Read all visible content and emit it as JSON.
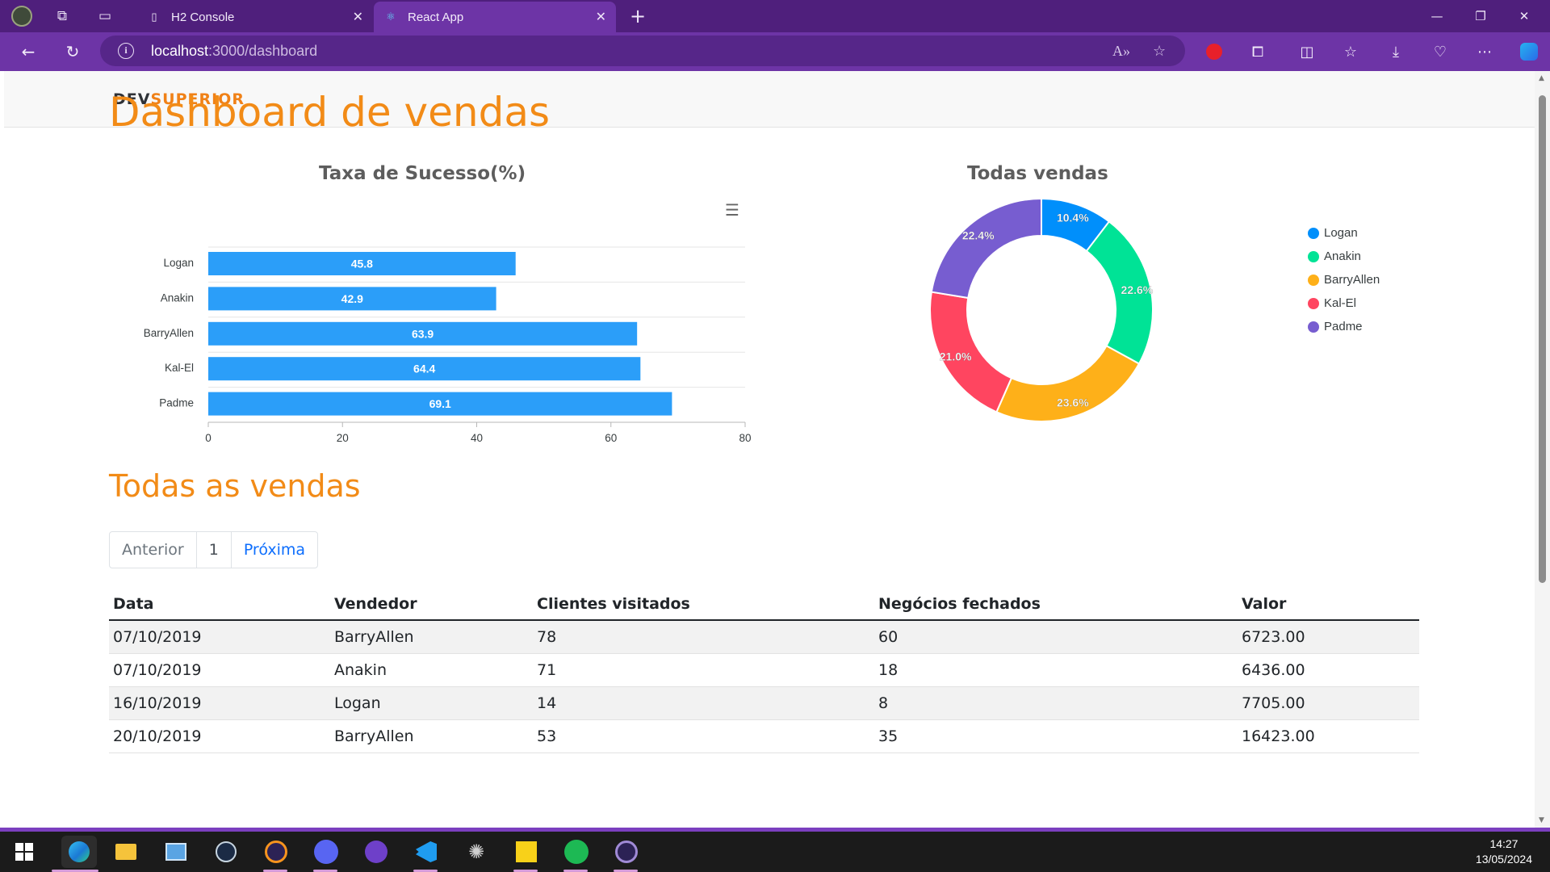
{
  "browser": {
    "tabs": [
      {
        "title": "H2 Console",
        "active": false
      },
      {
        "title": "React App",
        "active": true
      }
    ],
    "url_host": "localhost",
    "url_rest": ":3000/dashboard"
  },
  "site": {
    "logo_dev": "DEV",
    "logo_superior": "SUPERIOR",
    "page_title": "Dashboard de vendas",
    "section_title": "Todas as vendas"
  },
  "bar_chart_title": "Taxa de Sucesso(%)",
  "donut_chart_title": "Todas vendas",
  "colors": {
    "accent": "#f28b17",
    "bar": "#2b9ef9",
    "donut": [
      "#008ffb",
      "#00e396",
      "#feb019",
      "#ff4560",
      "#775dd0"
    ]
  },
  "chart_data": [
    {
      "type": "bar",
      "orientation": "horizontal",
      "title": "Taxa de Sucesso(%)",
      "categories": [
        "Logan",
        "Anakin",
        "BarryAllen",
        "Kal-El",
        "Padme"
      ],
      "values": [
        45.8,
        42.9,
        63.9,
        64.4,
        69.1
      ],
      "xlim": [
        0,
        80
      ],
      "xticks": [
        0,
        20,
        40,
        60,
        80
      ],
      "grid": true
    },
    {
      "type": "pie",
      "donut": true,
      "title": "Todas vendas",
      "labels": [
        "Logan",
        "Anakin",
        "BarryAllen",
        "Kal-El",
        "Padme"
      ],
      "values": [
        10.4,
        22.6,
        23.6,
        21.0,
        22.4
      ],
      "value_labels": [
        "10.4%",
        "22.6%",
        "23.6%",
        "21.0%",
        "22.4%"
      ],
      "legend": "right"
    }
  ],
  "pagination": {
    "prev": "Anterior",
    "current": "1",
    "next": "Próxima"
  },
  "table": {
    "headers": [
      "Data",
      "Vendedor",
      "Clientes visitados",
      "Negócios fechados",
      "Valor"
    ],
    "rows": [
      [
        "07/10/2019",
        "BarryAllen",
        "78",
        "60",
        "6723.00"
      ],
      [
        "07/10/2019",
        "Anakin",
        "71",
        "18",
        "6436.00"
      ],
      [
        "16/10/2019",
        "Logan",
        "14",
        "8",
        "7705.00"
      ],
      [
        "20/10/2019",
        "BarryAllen",
        "53",
        "35",
        "16423.00"
      ]
    ]
  },
  "taskbar": {
    "time": "14:27",
    "date": "13/05/2024",
    "icons": [
      "windows-start-icon",
      "edge-icon",
      "file-explorer-icon",
      "control-panel-icon",
      "steam-icon",
      "eclipse-icon",
      "discord-icon",
      "github-icon",
      "vscode-icon",
      "octopus-icon",
      "sticky-notes-icon",
      "spotify-icon",
      "eclipse-2-icon"
    ]
  }
}
